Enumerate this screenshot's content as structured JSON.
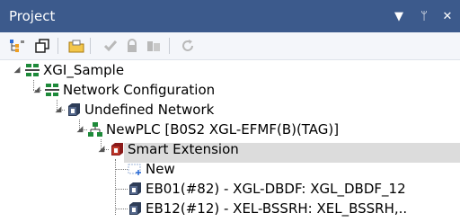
{
  "panel": {
    "title": "Project",
    "controls": {
      "dropdown": "▼",
      "pin": "ᛘ",
      "close": "✕"
    }
  },
  "toolbar": {
    "buttons": [
      "tree-view",
      "copy",
      "open-folder",
      "check",
      "lock",
      "security",
      "refresh"
    ]
  },
  "tree": {
    "items": [
      {
        "label": "XGI_Sample"
      },
      {
        "label": "Network Configuration"
      },
      {
        "label": "Undefined Network"
      },
      {
        "label": "NewPLC [B0S2 XGL-EFMF(B)(TAG)]"
      },
      {
        "label": "Smart Extension"
      },
      {
        "label": "New"
      },
      {
        "label": "EB01(#82) - XGL-DBDF: XGL_DBDF_12"
      },
      {
        "label": "EB12(#12) - XEL-BSSRH: XEL_BSSRH,.."
      }
    ]
  },
  "colors": {
    "titlebar": "#3c5a8c",
    "selected_row": "#dcdcdc"
  }
}
